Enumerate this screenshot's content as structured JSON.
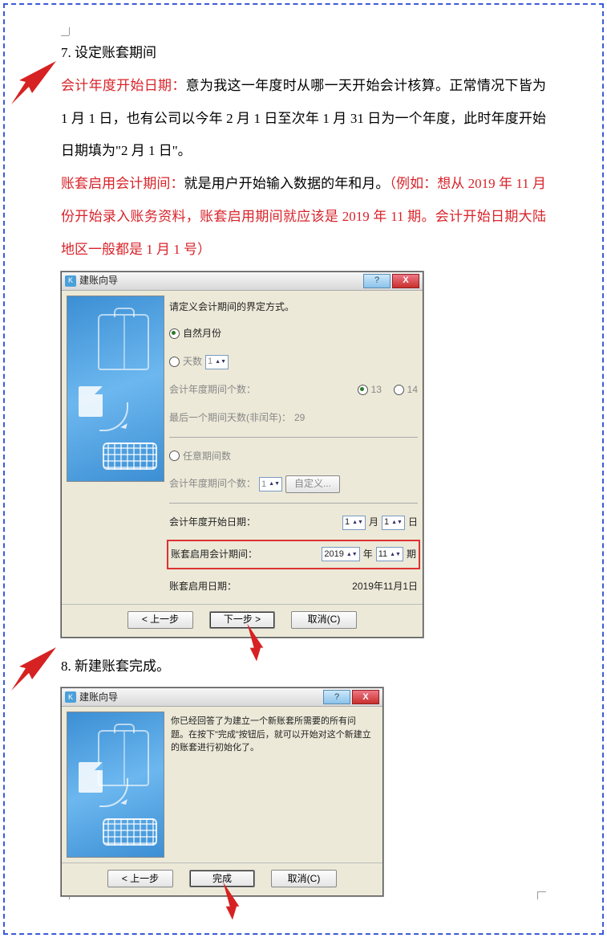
{
  "section7": {
    "number": "7.",
    "title": "设定账套期间",
    "p1_label": "会计年度开始日期：",
    "p1_body": "意为我这一年度时从哪一天开始会计核算。正常情况下皆为 1 月 1 日，也有公司以今年 2 月 1 日至次年 1 月 31 日为一个年度，此时年度开始日期填为\"2 月 1 日\"。",
    "p2_label": "账套启用会计期间：",
    "p2_body_black": "就是用户开始输入数据的年和月。",
    "p2_body_red": "（例如：想从 2019 年 11 月份开始录入账务资料，账套启用期间就应该是 2019 年 11 期。会计开始日期大陆地区一般都是 1 月 1 号）"
  },
  "dialog1": {
    "title": "建账向导",
    "intro": "请定义会计期间的界定方式。",
    "opt_natural": "自然月份",
    "opt_days": "天数",
    "days_value": "1",
    "periods_label": "会计年度期间个数：",
    "periods_13": "13",
    "periods_14": "14",
    "last_period_label": "最后一个期间天数(非闰年)：",
    "last_period_value": "29",
    "opt_custom": "任意期间数",
    "periods_value": "1",
    "btn_custom": "自定义...",
    "start_date_label": "会计年度开始日期：",
    "start_month": "1",
    "unit_month": "月",
    "start_day": "1",
    "unit_day": "日",
    "enable_period_label": "账套启用会计期间：",
    "enable_year": "2019",
    "unit_year": "年",
    "enable_period": "11",
    "unit_period": "期",
    "enable_date_label": "账套启用日期：",
    "enable_date_value": "2019年11月1日",
    "btn_prev": "< 上一步",
    "btn_next": "下一步 >",
    "btn_cancel": "取消(C)"
  },
  "section8": {
    "number": "8.",
    "title": "新建账套完成。"
  },
  "dialog2": {
    "title": "建账向导",
    "text": "你已经回答了为建立一个新账套所需要的所有问题。在按下\"完成\"按钮后，就可以开始对这个新建立的账套进行初始化了。",
    "btn_prev": "< 上一步",
    "btn_finish": "完成",
    "btn_cancel": "取消(C)"
  }
}
